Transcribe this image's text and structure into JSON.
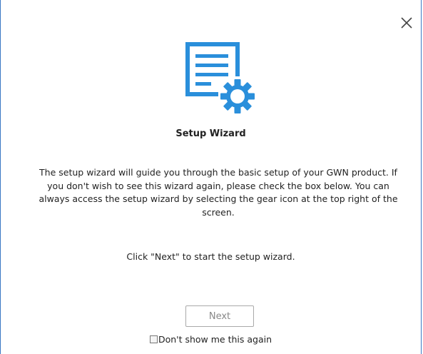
{
  "dialog": {
    "close_icon": "close-icon",
    "wizard_icon": "setup-document-gear-icon",
    "title": "Setup Wizard",
    "description": "The setup wizard will guide you through the basic setup of your GWN product. If you don't wish to see this wizard again, please check the box below. You can always access the setup wizard by selecting the gear icon at the top right of the screen.",
    "instruction": "Click \"Next\" to start the setup wizard.",
    "next_label": "Next",
    "dont_show_label": "Don't show me this again",
    "dont_show_checked": false
  },
  "colors": {
    "accent_blue": "#2a8fdb",
    "border_blue": "#3a78c3"
  }
}
